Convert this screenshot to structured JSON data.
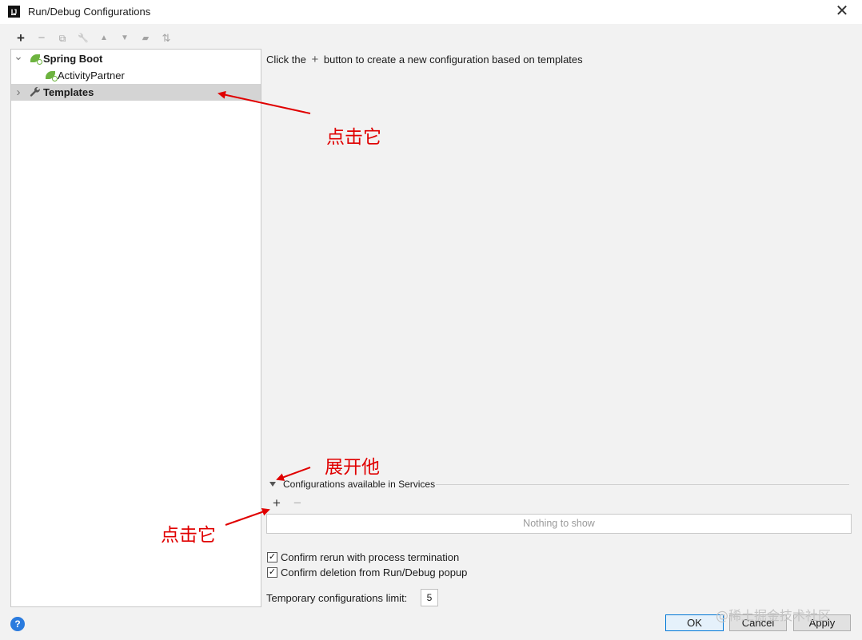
{
  "window": {
    "title": "Run/Debug Configurations",
    "logo_text": "IJ",
    "close_glyph": "✕"
  },
  "toolbar": {
    "add_glyph": "+",
    "remove_glyph": "−",
    "copy_glyph": "⧉",
    "wrench_glyph": "🔧",
    "up_glyph": "▲",
    "down_glyph": "▼",
    "folder_glyph": "▰",
    "sort_glyph": "⇅"
  },
  "tree": {
    "expanded_chevron": "⌄",
    "collapsed_chevron": "›",
    "spring_boot": "Spring Boot",
    "activity_partner": "ActivityPartner",
    "templates": "Templates"
  },
  "hint": {
    "before": "Click the",
    "plus": "+",
    "after": "button to create a new configuration based on templates"
  },
  "services": {
    "title": "Configurations available in Services",
    "add_glyph": "+",
    "remove_glyph": "−",
    "empty_text": "Nothing to show"
  },
  "options": {
    "confirm_rerun": "Confirm rerun with process termination",
    "confirm_deletion": "Confirm deletion from Run/Debug popup",
    "check_glyph": "✓",
    "limit_label": "Temporary configurations limit:",
    "limit_value": "5"
  },
  "footer": {
    "help": "?",
    "ok": "OK",
    "cancel": "Cancel",
    "apply": "Apply"
  },
  "annotations": {
    "click_it_1": "点击它",
    "expand_it": "展开他",
    "click_it_2": "点击它"
  },
  "watermark": "@稀土掘金技术社区",
  "colors": {
    "annotation": "#e00000",
    "selection": "#d4d4d4",
    "ok_border": "#0078d7"
  }
}
